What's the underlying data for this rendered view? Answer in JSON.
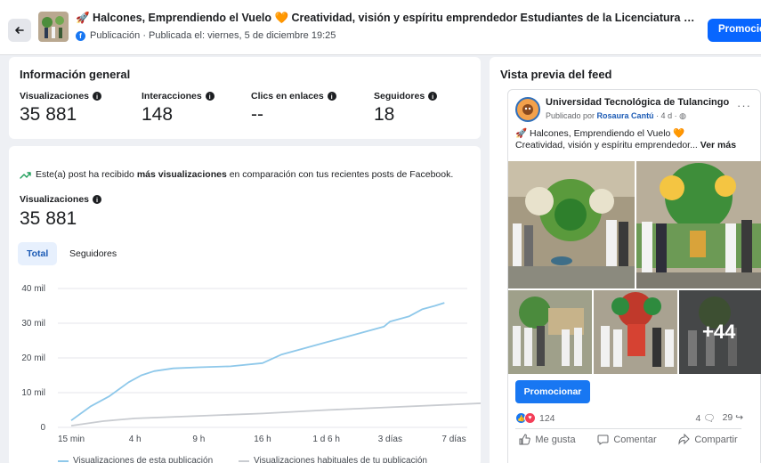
{
  "header": {
    "post_title": "🚀 Halcones, Emprendiendo el Vuelo 🧡 Creatividad, visión y espíritu emprendedor Estudiantes de la Licenciatura en Innovación d...",
    "subtitle": "Publicación · Publicada el: viernes, 5 de diciembre 19:25",
    "promote_label": "Promocion"
  },
  "overview": {
    "title": "Información general",
    "metrics": [
      {
        "label": "Visualizaciones",
        "value": "35 881"
      },
      {
        "label": "Interacciones",
        "value": "148"
      },
      {
        "label": "Clics en enlaces",
        "value": "--"
      },
      {
        "label": "Seguidores",
        "value": "18"
      }
    ]
  },
  "performance": {
    "trend_prefix": "Este(a) post ha recibido ",
    "trend_bold": "más visualizaciones",
    "trend_suffix": " en comparación con tus recientes posts de Facebook.",
    "views_label": "Visualizaciones",
    "views_value": "35 881",
    "tabs": [
      "Total",
      "Seguidores"
    ]
  },
  "chart_data": {
    "type": "line",
    "x_ticks": [
      "15 min",
      "4 h",
      "9 h",
      "16 h",
      "1 d 6 h",
      "3 días",
      "7 días"
    ],
    "y_ticks": [
      "0",
      "10 mil",
      "20 mil",
      "30 mil",
      "40 mil"
    ],
    "ylim": [
      0,
      40000
    ],
    "series": [
      {
        "name": "Visualizaciones de esta publicación",
        "color": "#8ec8ea",
        "x": [
          0,
          0.3,
          0.6,
          0.9,
          1.1,
          1.3,
          1.6,
          2,
          2.5,
          3,
          3.3,
          3.6,
          4,
          4.3,
          4.6,
          4.9,
          5,
          5.3,
          5.5,
          5.7,
          5.85
        ],
        "values": [
          2000,
          6000,
          9000,
          13000,
          15000,
          16200,
          17000,
          17300,
          17600,
          18500,
          21000,
          22500,
          24500,
          26000,
          27500,
          29000,
          30500,
          32000,
          34000,
          35000,
          35881
        ]
      },
      {
        "name": "Visualizaciones habituales de tu publicación",
        "color": "#c9ccd1",
        "x": [
          0,
          0.5,
          1,
          2,
          3,
          4,
          5,
          6.5
        ],
        "values": [
          500,
          1800,
          2600,
          3300,
          4000,
          5000,
          5800,
          7000
        ]
      }
    ]
  },
  "feed": {
    "title": "Vista previa del feed",
    "page_name": "Universidad Tecnológica de Tulancingo",
    "published_by_prefix": "Publicado por ",
    "published_by_name": "Rosaura Cantú",
    "published_meta": " · 4 d · ",
    "caption_line1": "🚀 Halcones, Emprendiendo el Vuelo 🧡",
    "caption_line2": "Creatividad, visión y espíritu emprendedor... ",
    "see_more": "Ver más",
    "more_photos": "+44",
    "promote_button": "Promocionar",
    "reactions_count": "124",
    "comments_count": "4",
    "shares_count": "29",
    "actions": [
      "Me gusta",
      "Comentar",
      "Compartir"
    ]
  }
}
